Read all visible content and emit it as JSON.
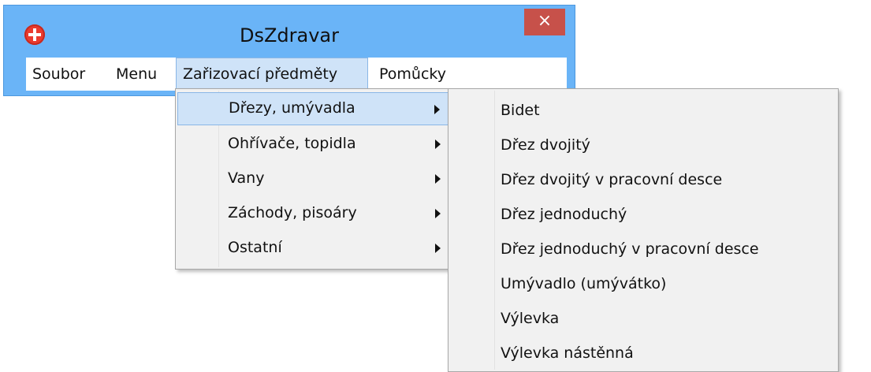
{
  "window": {
    "title": "DsZdravar",
    "close_glyph": "×",
    "icon": "app-cross-icon",
    "accent_color": "#6ab4f7"
  },
  "menubar": {
    "items": [
      {
        "label": "Soubor"
      },
      {
        "label": "Menu"
      },
      {
        "label": "Zařizovací předměty"
      },
      {
        "label": "Pomůcky"
      }
    ]
  },
  "dropdown": {
    "items": [
      {
        "label": "Dřezy, umývadla"
      },
      {
        "label": "Ohřívače, topidla"
      },
      {
        "label": "Vany"
      },
      {
        "label": "Záchody, pisoáry"
      },
      {
        "label": "Ostatní"
      }
    ]
  },
  "submenu": {
    "items": [
      {
        "label": "Bidet"
      },
      {
        "label": "Dřez dvojitý"
      },
      {
        "label": "Dřez dvojitý v pracovní desce"
      },
      {
        "label": "Dřez jednoduchý"
      },
      {
        "label": "Dřez jednoduchý v pracovní desce"
      },
      {
        "label": "Umývadlo (umývátko)"
      },
      {
        "label": "Výlevka"
      },
      {
        "label": "Výlevka nástěnná"
      }
    ]
  }
}
